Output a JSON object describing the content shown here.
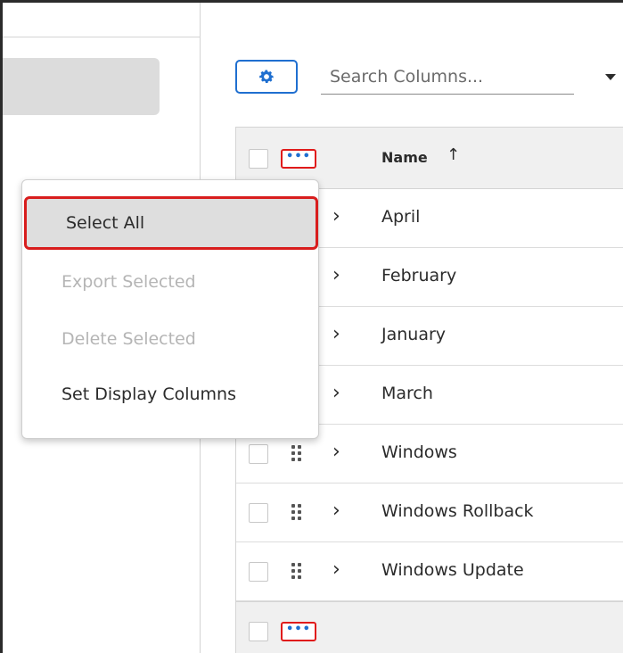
{
  "toolbar": {
    "settings_icon": "gear-icon",
    "search_placeholder": "Search Columns..."
  },
  "table": {
    "header": {
      "name_label": "Name",
      "sort_glyph": "↑",
      "more_glyph": "•••"
    },
    "rows": [
      {
        "label": "April"
      },
      {
        "label": "February"
      },
      {
        "label": "January"
      },
      {
        "label": "March"
      },
      {
        "label": "Windows"
      },
      {
        "label": "Windows Rollback"
      },
      {
        "label": "Windows Update"
      }
    ],
    "chevron_glyph": "›",
    "footer": {
      "more_glyph": "•••"
    }
  },
  "menu": {
    "items": [
      {
        "label": "Select All",
        "state": "highlighted"
      },
      {
        "label": "Export Selected",
        "state": "disabled"
      },
      {
        "label": "Delete Selected",
        "state": "disabled"
      },
      {
        "label": "Set Display Columns",
        "state": "enabled"
      }
    ]
  },
  "colors": {
    "accent": "#1f6fd0",
    "highlight_outline": "#d81d1d",
    "disabled_text": "#b5b5b5"
  }
}
